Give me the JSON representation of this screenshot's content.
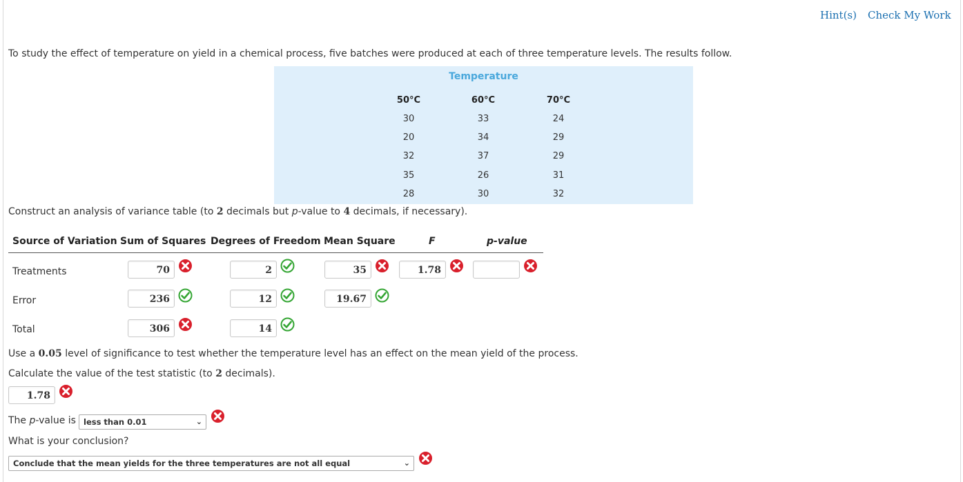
{
  "header": {
    "hints": "Hint(s)",
    "check": "Check My Work"
  },
  "intro": "To study the effect of temperature on yield in a chemical process, five batches were produced at each of three temperature levels. The results follow.",
  "temp_table": {
    "title": "Temperature",
    "columns": [
      "50°C",
      "60°C",
      "70°C"
    ],
    "rows": [
      [
        "30",
        "33",
        "24"
      ],
      [
        "20",
        "34",
        "29"
      ],
      [
        "32",
        "37",
        "29"
      ],
      [
        "35",
        "26",
        "31"
      ],
      [
        "28",
        "30",
        "32"
      ]
    ]
  },
  "construct": {
    "a": "Construct an analysis of variance table (to ",
    "b": "2",
    "c": " decimals but ",
    "d": "p",
    "e": "-value to ",
    "f": "4",
    "g": " decimals, if necessary)."
  },
  "anova": {
    "headers": [
      "Source of Variation",
      "Sum of Squares",
      "Degrees of Freedom",
      "Mean Square",
      "F",
      "p-value"
    ],
    "treatments": {
      "label": "Treatments",
      "ss": "70",
      "df": "2",
      "ms": "35",
      "f": "1.78",
      "p": ""
    },
    "error": {
      "label": "Error",
      "ss": "236",
      "df": "12",
      "ms": "19.67"
    },
    "total": {
      "label": "Total",
      "ss": "306",
      "df": "14"
    }
  },
  "q_sig": {
    "a": "Use a ",
    "b": "0.05",
    "c": " level of significance to test whether the temperature level has an effect on the mean yield of the process."
  },
  "q_stat": {
    "a": "Calculate the value of the test statistic (to ",
    "b": "2",
    "c": " decimals).",
    "value": "1.78"
  },
  "q_p": {
    "a": "The ",
    "b": "p",
    "c": "-value is",
    "selected": "less than 0.01"
  },
  "q_conc": {
    "label": "What is your conclusion?",
    "selected": "Conclude that the mean yields for the three temperatures are not all equal"
  },
  "colors": {
    "accent": "#1a6fb0",
    "table_bg": "#dfeffb",
    "header_blue": "#4aa8dc",
    "correct": "#33a532",
    "incorrect": "#d9202c"
  }
}
